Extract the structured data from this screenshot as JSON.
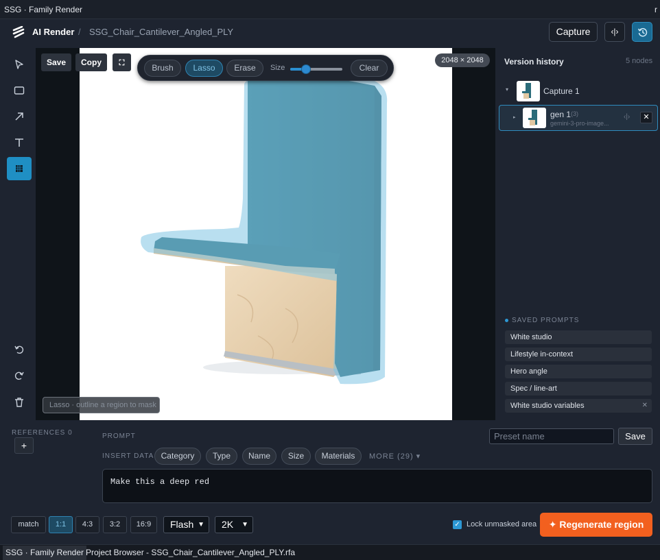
{
  "window": {
    "title": "SSG · Family Render",
    "corner_glyph": "r"
  },
  "header": {
    "app_name": "AI Render",
    "separator": "/",
    "document": "SSG_Chair_Cantilever_Angled_PLY",
    "capture_label": "Capture",
    "compare_icon": "compare-icon",
    "history_icon": "history-icon"
  },
  "tools": [
    "select-arrow-icon",
    "rectangle-icon",
    "arrow-icon",
    "text-icon",
    "mask-tool-icon",
    "undo-icon",
    "redo-icon",
    "trash-icon"
  ],
  "canvas": {
    "save_label": "Save",
    "copy_label": "Copy",
    "fullscreen_icon": "fullscreen-icon",
    "dimensions": "2048 × 2048",
    "hint": "Lasso · outline a region to mask",
    "mask_toolbar": {
      "brush": "Brush",
      "lasso": "Lasso",
      "erase": "Erase",
      "size_label": "Size",
      "size_value": 0.3,
      "clear": "Clear",
      "active_mode": "Lasso"
    }
  },
  "history": {
    "title": "Version history",
    "count": "5 nodes",
    "nodes": [
      {
        "label": "Capture 1",
        "expanded": true
      },
      {
        "label": "gen 1",
        "badge": "(3)",
        "model": "gemini-3-pro-image...",
        "selected": true
      }
    ]
  },
  "saved_prompts": {
    "title": "SAVED PROMPTS",
    "items": [
      "White studio",
      "Lifestyle in-context",
      "Hero angle",
      "Spec / line-art",
      "White studio variables"
    ]
  },
  "bottom": {
    "references_label": "REFERENCES 0",
    "add_reference": "+",
    "prompt_label": "PROMPT",
    "preset_placeholder": "Preset name",
    "preset_save": "Save",
    "insert_label": "INSERT DATA",
    "chips": [
      "Category",
      "Type",
      "Name",
      "Size",
      "Materials"
    ],
    "more": "MORE (29) ▾",
    "prompt_text": "Make this a deep red",
    "aspect_ratios": [
      "match",
      "1:1",
      "4:3",
      "3:2",
      "16:9"
    ],
    "aspect_active": "1:1",
    "model": "Flash",
    "resolution": "2K",
    "lock_label": "Lock unmasked area",
    "lock_checked": true,
    "regenerate": "✦ Regenerate region"
  },
  "taskbar": {
    "items": [
      "SSG · Family Render",
      "Project Browser - SSG_Chair_Cantilever_Angled_PLY.rfa"
    ]
  },
  "colors": {
    "background": "#1e2430",
    "accent": "#2d98d4",
    "cta": "#f2601f",
    "mask": "#7fc4e3",
    "chair_fabric": "#2b6c7a",
    "chair_wood": "#e7d1b0"
  }
}
